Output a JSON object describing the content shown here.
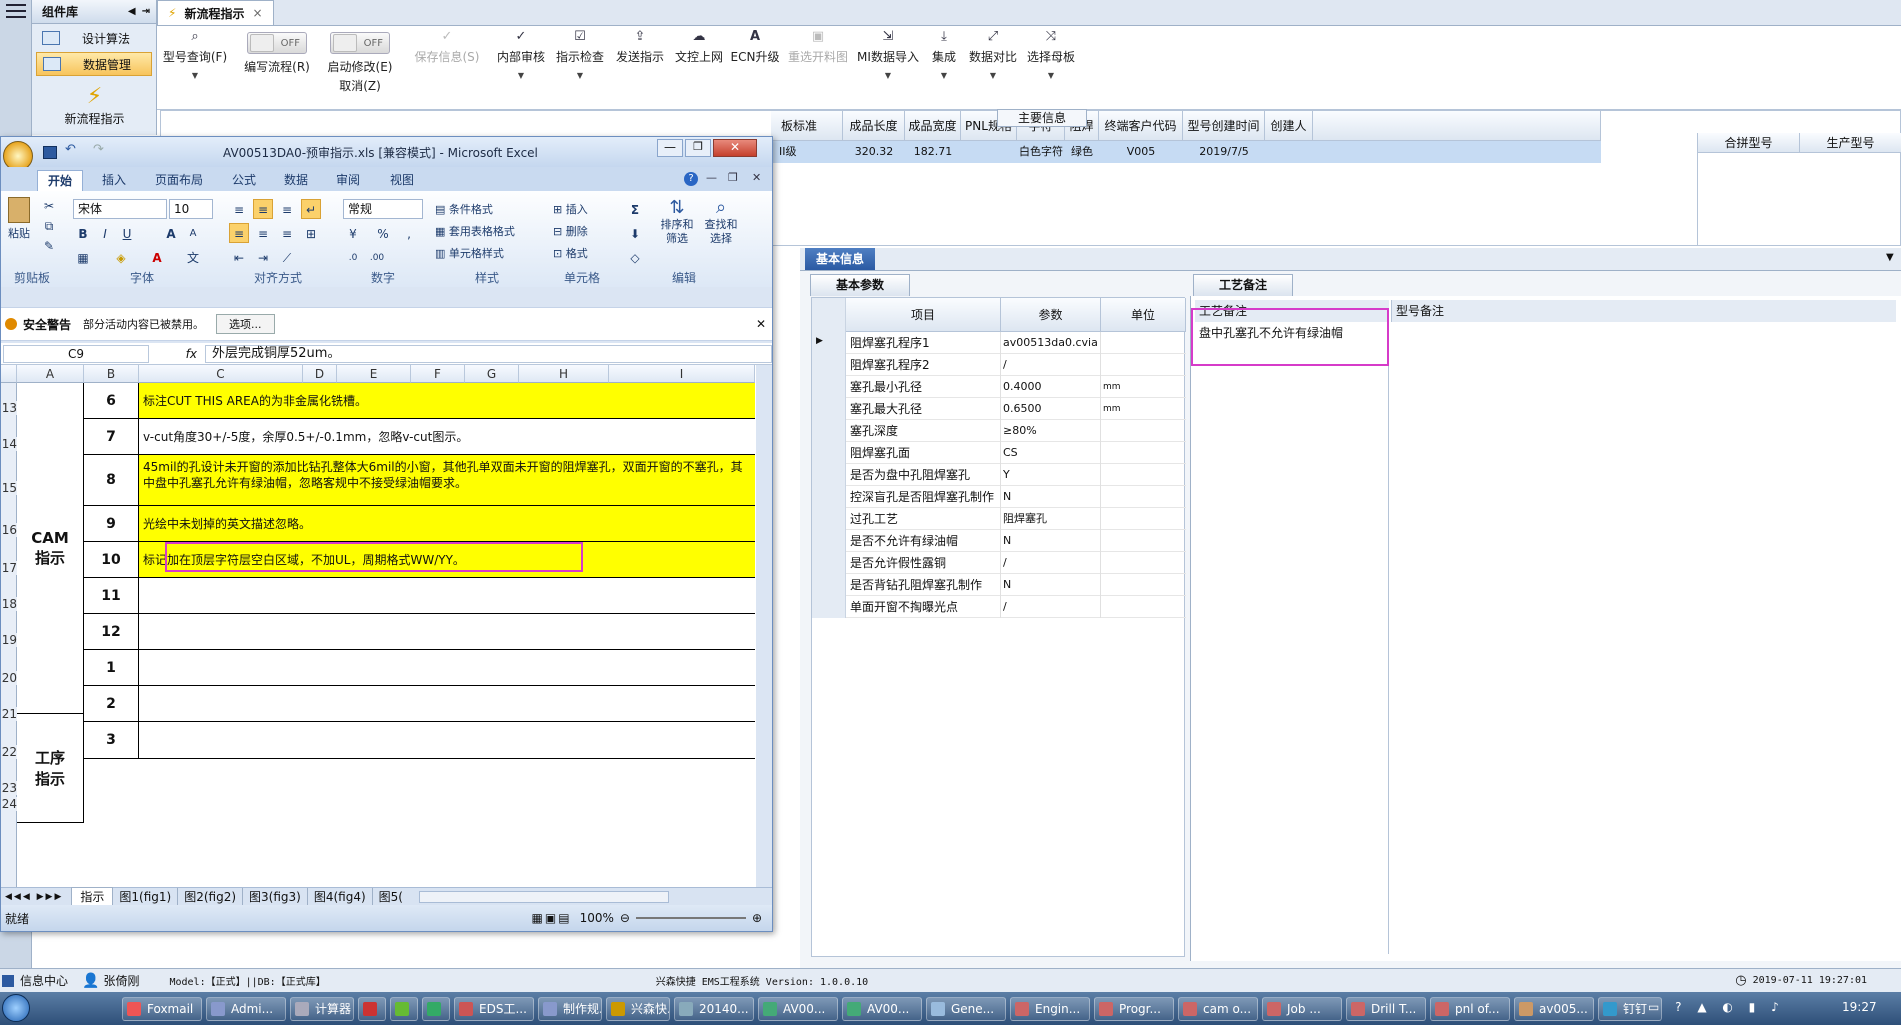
{
  "component_library": {
    "title": "组件库",
    "items": [
      {
        "label": "设计算法"
      },
      {
        "label": "数据管理"
      }
    ],
    "new_flow_label": "新流程指示"
  },
  "app_tab": {
    "label": "新流程指示"
  },
  "toolbar": [
    {
      "label": "型号查询(F)",
      "icon": "search-icon",
      "dropdown": true,
      "enabled": true
    },
    {
      "label": "编写流程(R)",
      "toggle": "OFF",
      "enabled": true
    },
    {
      "label": "启动修改(E)",
      "sub": "取消(Z)",
      "toggle": "OFF",
      "enabled": true
    },
    {
      "label": "保存信息(S)",
      "icon": "check-icon",
      "enabled": false
    },
    {
      "label": "内部审核",
      "icon": "check-icon",
      "dropdown": true,
      "enabled": true
    },
    {
      "label": "指示检查",
      "icon": "check-doc-icon",
      "dropdown": true,
      "enabled": true
    },
    {
      "label": "发送指示",
      "icon": "upload-icon",
      "enabled": true
    },
    {
      "label": "文控上网",
      "icon": "cloud-upload-icon",
      "enabled": true
    },
    {
      "label": "ECN升级",
      "icon": "font-a-icon",
      "enabled": true
    },
    {
      "label": "重选开料图",
      "icon": "image-icon",
      "enabled": false
    },
    {
      "label": "MI数据导入",
      "icon": "import-icon",
      "dropdown": true,
      "enabled": true
    },
    {
      "label": "集成",
      "icon": "download-icon",
      "dropdown": true,
      "enabled": true
    },
    {
      "label": "数据对比",
      "icon": "compare-icon",
      "dropdown": true,
      "enabled": true
    },
    {
      "label": "选择母板",
      "icon": "shuffle-icon",
      "dropdown": true,
      "enabled": true
    }
  ],
  "main_info": {
    "title": "主要信息",
    "columns": [
      "成品长度",
      "成品宽度",
      "PNL规格",
      "字符",
      "阻焊",
      "终端客户代码",
      "型号创建时间",
      "创建人"
    ],
    "partial_first_col": "板标准",
    "row": {
      "first": "II级",
      "cells": [
        "320.32",
        "182.71",
        "",
        "白色字符",
        "绿色",
        "V005",
        "2019/7/5",
        ""
      ]
    },
    "side_columns": [
      "合拼型号",
      "生产型号"
    ]
  },
  "basic_info": {
    "title": "基本信息",
    "tab_params": "基本参数",
    "tab_remark": "工艺备注",
    "headers": [
      "项目",
      "参数",
      "单位"
    ],
    "rows": [
      {
        "item": "阻焊塞孔程序1",
        "value": "av00513da0.cvia",
        "unit": ""
      },
      {
        "item": "阻焊塞孔程序2",
        "value": "/",
        "unit": ""
      },
      {
        "item": "塞孔最小孔径",
        "value": "0.4000",
        "unit": "mm"
      },
      {
        "item": "塞孔最大孔径",
        "value": "0.6500",
        "unit": "mm"
      },
      {
        "item": "塞孔深度",
        "value": "≥80%",
        "unit": ""
      },
      {
        "item": "阻焊塞孔面",
        "value": "CS",
        "unit": ""
      },
      {
        "item": "是否为盘中孔阻焊塞孔",
        "value": "Y",
        "unit": ""
      },
      {
        "item": "控深盲孔是否阻焊塞孔制作",
        "value": "N",
        "unit": ""
      },
      {
        "item": "过孔工艺",
        "value": "阻焊塞孔",
        "unit": ""
      },
      {
        "item": "是否不允许有绿油帽",
        "value": "N",
        "unit": ""
      },
      {
        "item": "是否允许假性露铜",
        "value": "/",
        "unit": ""
      },
      {
        "item": "是否背钻孔阻焊塞孔制作",
        "value": "N",
        "unit": ""
      },
      {
        "item": "单面开窗不掏曝光点",
        "value": "/",
        "unit": ""
      }
    ],
    "remark_header": "工艺备注",
    "model_remark_header": "型号备注",
    "remark_text": "盘中孔塞孔不允许有绿油帽"
  },
  "excel": {
    "title": "AV00513DA0-预审指示.xls  [兼容模式] - Microsoft Excel",
    "tabs": [
      "开始",
      "插入",
      "页面布局",
      "公式",
      "数据",
      "审阅",
      "视图"
    ],
    "font_name": "宋体",
    "font_size": "10",
    "number_format": "常规",
    "groups": [
      "剪贴板",
      "字体",
      "对齐方式",
      "数字",
      "样式",
      "单元格",
      "编辑"
    ],
    "paste": "粘贴",
    "style_items": [
      "条件格式",
      "套用表格格式",
      "单元格样式"
    ],
    "cell_items": [
      "插入",
      "删除",
      "格式"
    ],
    "edit_items": [
      "排序和筛选",
      "查找和选择"
    ],
    "security_title": "安全警告",
    "security_text": "部分活动内容已被禁用。",
    "security_btn": "选项...",
    "name_box": "C9",
    "formula": "外层完成铜厚52um。",
    "columns": [
      "A",
      "B",
      "C",
      "D",
      "E",
      "F",
      "G",
      "H",
      "I"
    ],
    "row_numbers": [
      "13",
      "14",
      "15",
      "16",
      "17",
      "18",
      "19",
      "20",
      "21",
      "22",
      "23",
      "24"
    ],
    "cam_label": "CAM\n指示",
    "process_label": "工序\n指示",
    "rows": [
      {
        "n": "6",
        "text": "标注CUT THIS AREA的为非金属化铣槽。",
        "yellow": true
      },
      {
        "n": "7",
        "text": "v-cut角度30+/-5度，余厚0.5+/-0.1mm，忽略v-cut图示。",
        "yellow": false
      },
      {
        "n": "8",
        "text": "45mil的孔设计未开窗的添加比钻孔整体大6mil的小窗，其他孔单双面未开窗的阻焊塞孔，双面开窗的不塞孔，其中盘中孔塞孔允许有绿油帽，忽略客规中不接受绿油帽要求。",
        "yellow": true
      },
      {
        "n": "9",
        "text": "光绘中未划掉的英文描述忽略。",
        "yellow": true
      },
      {
        "n": "10",
        "text": "标记加在顶层字符层空白区域，不加UL，周期格式WW/YY。",
        "yellow": true
      },
      {
        "n": "11",
        "text": "",
        "yellow": false
      },
      {
        "n": "12",
        "text": "",
        "yellow": false
      },
      {
        "n": "1",
        "text": "",
        "yellow": false
      },
      {
        "n": "2",
        "text": "",
        "yellow": false
      },
      {
        "n": "3",
        "text": "",
        "yellow": false
      }
    ],
    "sheet_tabs": [
      "指示",
      "图1(fig1)",
      "图2(fig2)",
      "图3(fig3)",
      "图4(fig4)",
      "图5("
    ],
    "status": "就绪",
    "zoom": "100%"
  },
  "statusbar": {
    "info_center": "信息中心",
    "user": "张倚刚",
    "model_db": "Model:【正式】||DB:【正式库】",
    "system": "兴森快捷 EMS工程系统 Version: 1.0.0.10",
    "datetime": "2019-07-11 19:27:01"
  },
  "taskbar": {
    "items": [
      "Foxmail",
      "Admi...",
      "计算器",
      "",
      "",
      "",
      "EDS工...",
      "制作规...",
      "兴森快...",
      "20140...",
      "AV00...",
      "AV00...",
      "Gene...",
      "Engin...",
      "Progr...",
      "cam o...",
      "Job ...",
      "Drill T...",
      "pnl of...",
      "av005...",
      "钉钉"
    ],
    "time": "19:27"
  }
}
